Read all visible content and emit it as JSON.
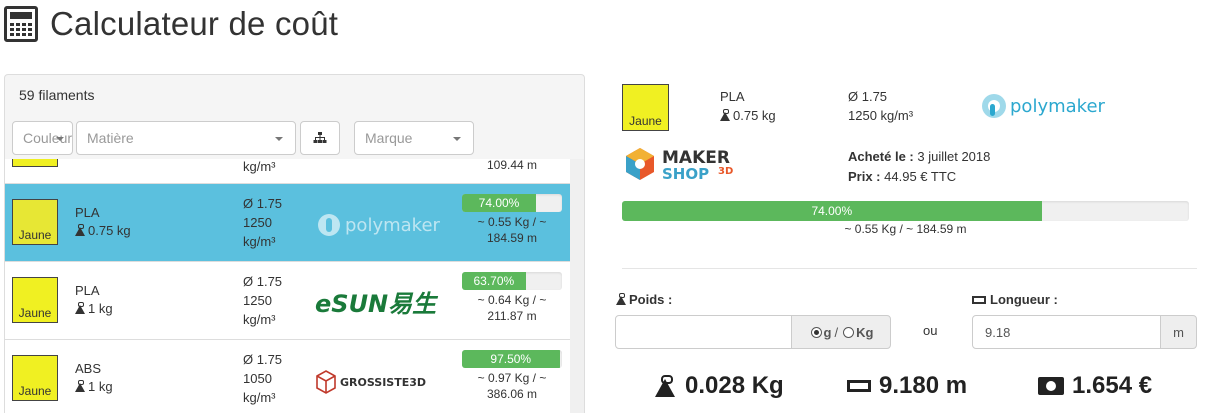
{
  "page": {
    "title": "Calculateur de coût"
  },
  "list": {
    "count_label": "59 filaments",
    "filters": {
      "color_placeholder": "Couleur",
      "material_placeholder": "Matière",
      "brand_placeholder": "Marque"
    },
    "partial_row": {
      "dims_unit": "kg/m³",
      "usage_length": "109.44 m"
    },
    "rows": [
      {
        "color_label": "Jaune",
        "material": "PLA",
        "weight": "0.75 kg",
        "diameter": "Ø 1.75",
        "density_value": "1250",
        "density_unit": "kg/m³",
        "brand": "polymaker",
        "percent": "74.00%",
        "percent_value": 74.0,
        "usage_weight": "~ 0.55 Kg / ~",
        "usage_length": "184.59 m",
        "active": true
      },
      {
        "color_label": "Jaune",
        "material": "PLA",
        "weight": "1 kg",
        "diameter": "Ø 1.75",
        "density_value": "1250",
        "density_unit": "kg/m³",
        "brand": "eSUN易生",
        "percent": "63.70%",
        "percent_value": 63.7,
        "usage_weight": "~ 0.64 Kg / ~",
        "usage_length": "211.87 m",
        "active": false
      },
      {
        "color_label": "Jaune",
        "material": "ABS",
        "weight": "1 kg",
        "diameter": "Ø 1.75",
        "density_value": "1050",
        "density_unit": "kg/m³",
        "brand": "GROSSISTE3D",
        "percent": "97.50%",
        "percent_value": 97.5,
        "usage_weight": "~ 0.97 Kg / ~",
        "usage_length": "386.06 m",
        "active": false
      }
    ]
  },
  "detail": {
    "color_label": "Jaune",
    "material": "PLA",
    "weight": "0.75 kg",
    "diameter": "Ø 1.75",
    "density": "1250 kg/m³",
    "brand": "polymaker",
    "shop": {
      "line1": "MAKER",
      "line2": "SHOP",
      "suffix": "3D"
    },
    "bought_label": "Acheté le :",
    "bought_date": "3 juillet 2018",
    "price_label": "Prix :",
    "price_value": "44.95 € TTC",
    "percent": "74.00%",
    "percent_value": 74.0,
    "usage": "~ 0.55 Kg / ~ 184.59 m"
  },
  "calc": {
    "weight_label": "Poids :",
    "unit_g": "g",
    "unit_sep": "/",
    "unit_kg": "Kg",
    "or_label": "ou",
    "length_label": "Longueur :",
    "length_value": "9.18",
    "length_unit": "m",
    "result_weight": "0.028 Kg",
    "result_length": "9.180 m",
    "result_cost": "1.654 €"
  },
  "colors": {
    "accent_active": "#5bc0de",
    "progress": "#5cb85c",
    "swatch": "#f0f022"
  }
}
